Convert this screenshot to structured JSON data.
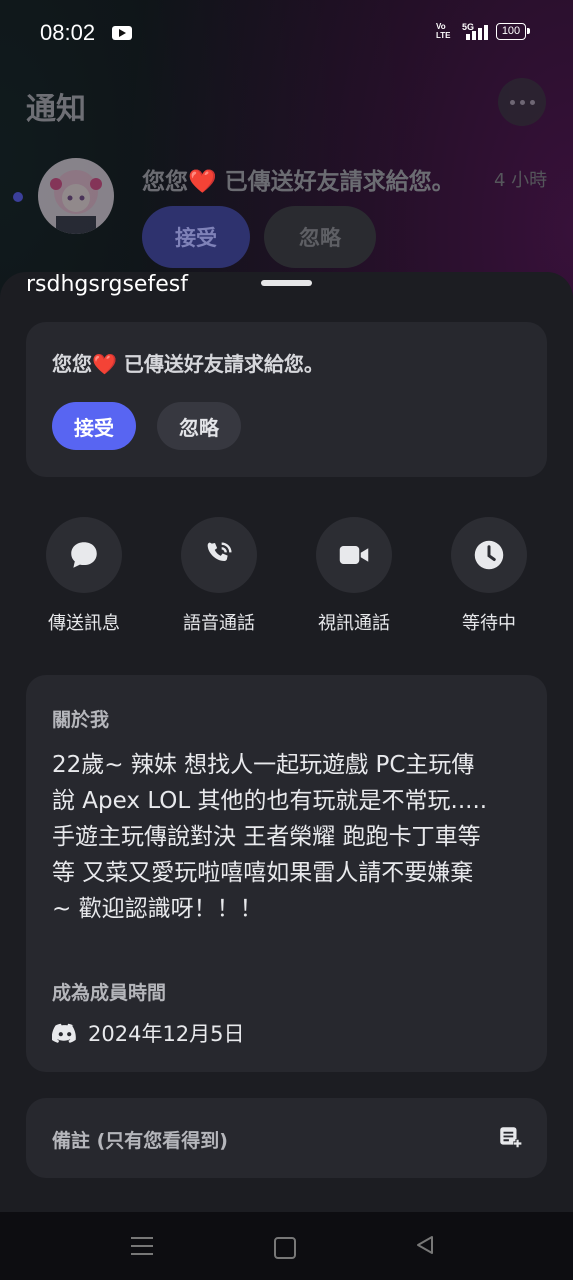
{
  "status_bar": {
    "time": "08:02",
    "volte_top": "Vo",
    "volte_bottom": "LTE",
    "network": "5G",
    "battery": "100"
  },
  "background": {
    "title": "通知",
    "notification_text": "您您❤️ 已傳送好友請求給您。",
    "notification_time": "4 小時",
    "accept_label": "接受",
    "ignore_label": "忽略"
  },
  "sheet": {
    "username": "rsdhgsrgsefesf",
    "request": {
      "text": "您您❤️ 已傳送好友請求給您。",
      "accept_label": "接受",
      "ignore_label": "忽略"
    },
    "actions": [
      {
        "label": "傳送訊息",
        "icon": "chat-bubble-icon"
      },
      {
        "label": "語音通話",
        "icon": "phone-icon"
      },
      {
        "label": "視訊通話",
        "icon": "video-camera-icon"
      },
      {
        "label": "等待中",
        "icon": "clock-icon"
      }
    ],
    "about": {
      "heading": "關於我",
      "body": "22歲~ 辣妹 想找人一起玩遊戲 PC主玩傳\n說  Apex LOL 其他的也有玩就是不常玩.....\n手遊主玩傳說對決 王者榮耀 跑跑卡丁車等\n等 又菜又愛玩啦嘻嘻如果雷人請不要嫌棄\n~ 歡迎認識呀！！！",
      "member_heading": "成為成員時間",
      "member_date": "2024年12月5日"
    },
    "note": {
      "label": "備註 (只有您看得到)"
    }
  },
  "colors": {
    "accent": "#5865f2",
    "sheet_bg": "#1c1d22",
    "card_bg": "#27282e"
  }
}
